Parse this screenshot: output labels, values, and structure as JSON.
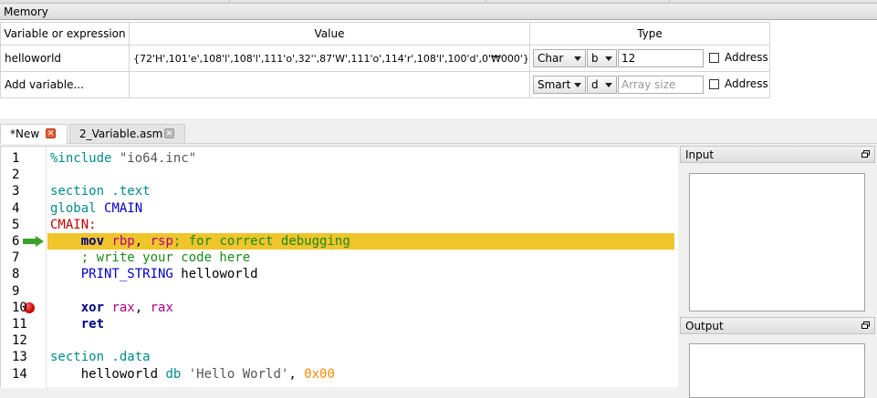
{
  "memory": {
    "title": "Memory",
    "headers": {
      "variable": "Variable or expression",
      "value": "Value",
      "type": "Type"
    },
    "rows": [
      {
        "variable": "helloworld",
        "value": "{72'H',101'e',108'l',108'l',111'o',32'',87'W',111'o',114'r',108'l',100'd',0'₩000'}",
        "type_select": "Char",
        "format_select": "b",
        "size_value": "12",
        "size_placeholder": "",
        "address_label": "Address",
        "address_checked": false
      },
      {
        "variable": "Add variable...",
        "value": "",
        "type_select": "Smart",
        "format_select": "d",
        "size_value": "",
        "size_placeholder": "Array size",
        "address_label": "Address",
        "address_checked": false
      }
    ]
  },
  "tabs": [
    {
      "label": "*New",
      "active": true
    },
    {
      "label": "2_Variable.asm",
      "active": false
    }
  ],
  "editor": {
    "current_line": 6,
    "breakpoint_line": 10,
    "lines": [
      {
        "n": "1",
        "tokens": [
          {
            "t": "%include ",
            "c": "dir"
          },
          {
            "t": "\"io64.inc\"",
            "c": "str"
          }
        ]
      },
      {
        "n": "2",
        "tokens": []
      },
      {
        "n": "3",
        "tokens": [
          {
            "t": "section .text",
            "c": "sec"
          }
        ]
      },
      {
        "n": "4",
        "tokens": [
          {
            "t": "global ",
            "c": "sec"
          },
          {
            "t": "CMAIN",
            "c": "id"
          }
        ]
      },
      {
        "n": "5",
        "tokens": [
          {
            "t": "CMAIN:",
            "c": "lab"
          }
        ]
      },
      {
        "n": "6",
        "tokens": [
          {
            "t": "    ",
            "c": "plain"
          },
          {
            "t": "mov ",
            "c": "ins"
          },
          {
            "t": "rbp",
            "c": "reg"
          },
          {
            "t": ", ",
            "c": "plain"
          },
          {
            "t": "rsp",
            "c": "reg"
          },
          {
            "t": "; for correct debugging",
            "c": "cmt"
          }
        ]
      },
      {
        "n": "7",
        "tokens": [
          {
            "t": "    ",
            "c": "plain"
          },
          {
            "t": "; write your code here",
            "c": "cmt"
          }
        ]
      },
      {
        "n": "8",
        "tokens": [
          {
            "t": "    ",
            "c": "plain"
          },
          {
            "t": "PRINT_STRING ",
            "c": "mac"
          },
          {
            "t": "helloworld",
            "c": "var"
          }
        ]
      },
      {
        "n": "9",
        "tokens": []
      },
      {
        "n": "10",
        "tokens": [
          {
            "t": "    ",
            "c": "plain"
          },
          {
            "t": "xor ",
            "c": "ins"
          },
          {
            "t": "rax",
            "c": "reg"
          },
          {
            "t": ", ",
            "c": "plain"
          },
          {
            "t": "rax",
            "c": "reg"
          }
        ]
      },
      {
        "n": "11",
        "tokens": [
          {
            "t": "    ",
            "c": "plain"
          },
          {
            "t": "ret",
            "c": "ins"
          }
        ]
      },
      {
        "n": "12",
        "tokens": []
      },
      {
        "n": "13",
        "tokens": [
          {
            "t": "section .data",
            "c": "sec"
          }
        ]
      },
      {
        "n": "14",
        "tokens": [
          {
            "t": "    ",
            "c": "plain"
          },
          {
            "t": "helloworld ",
            "c": "var"
          },
          {
            "t": "db ",
            "c": "sec"
          },
          {
            "t": "'Hello World'",
            "c": "str"
          },
          {
            "t": ", ",
            "c": "plain"
          },
          {
            "t": "0x00",
            "c": "num"
          }
        ]
      }
    ]
  },
  "panels": {
    "input_title": "Input",
    "output_title": "Output"
  },
  "colors": {
    "current_line_highlight": "#f0c52c",
    "breakpoint": "#d00000",
    "debug_arrow": "#3aa12a",
    "tab_close_active": "#e35d35"
  }
}
